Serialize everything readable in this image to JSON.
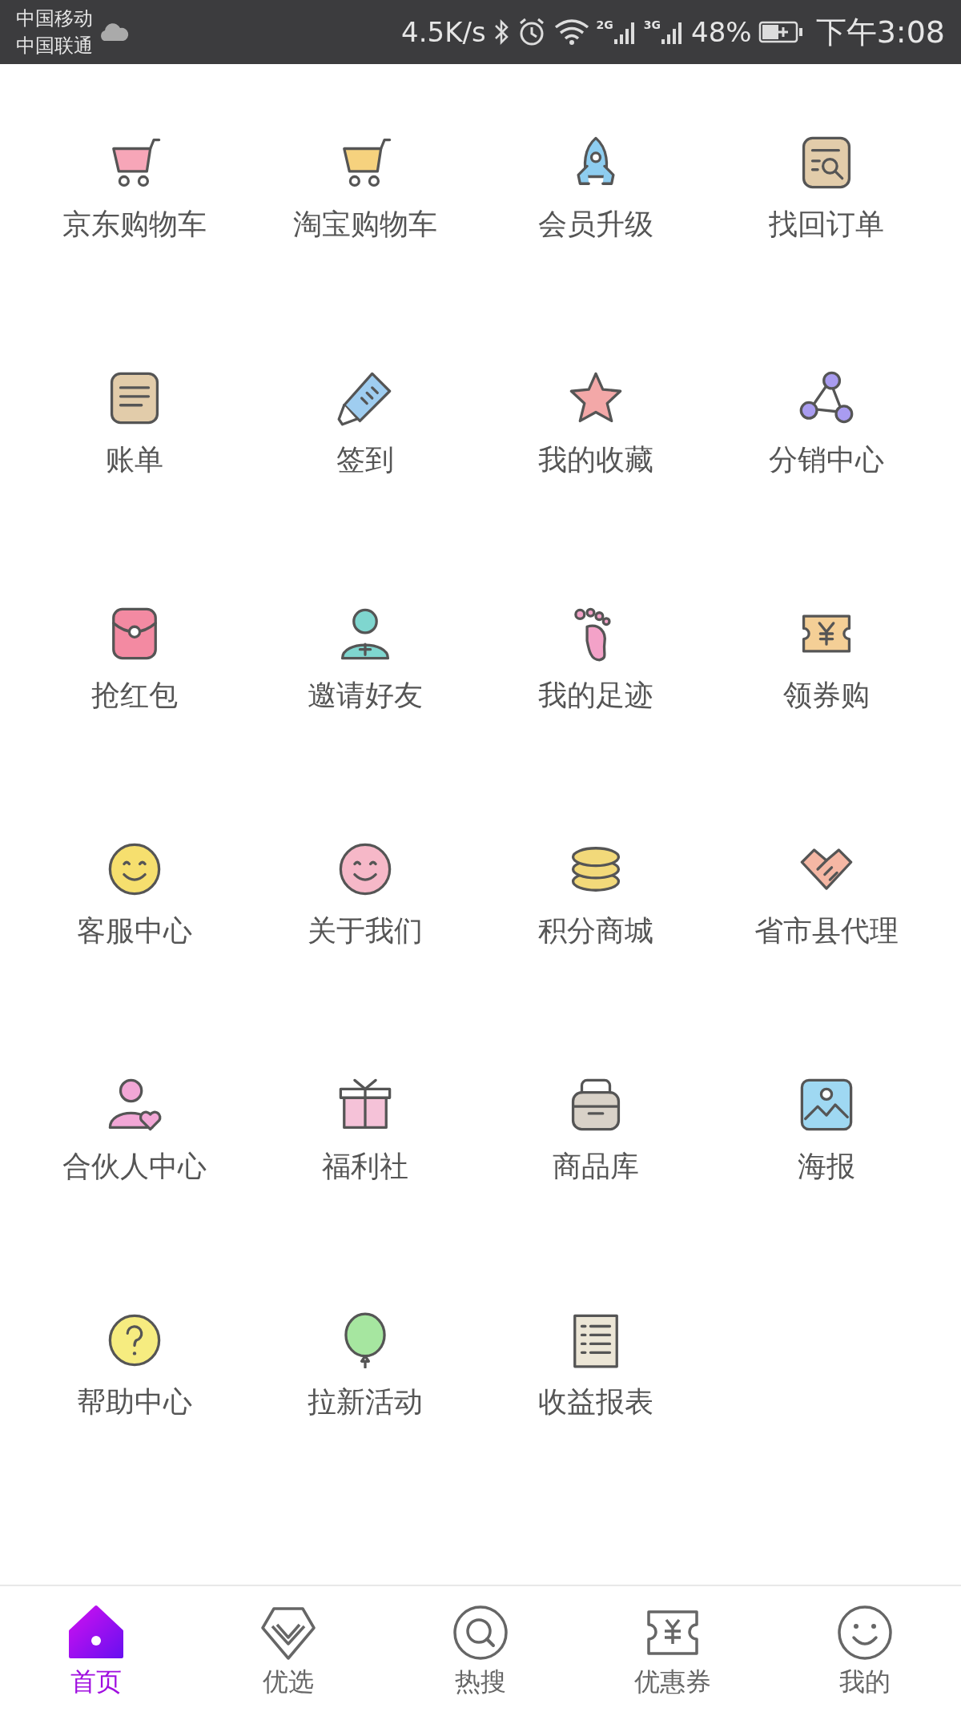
{
  "status_bar": {
    "carriers": [
      "中国移动",
      "中国联通"
    ],
    "speed": "4.5K/s",
    "networks": [
      "2G",
      "3G"
    ],
    "battery": "48%",
    "time": "下午3:08"
  },
  "grid": [
    {
      "label": "京东购物车",
      "kind": "cart",
      "color": "#f7a6b8"
    },
    {
      "label": "淘宝购物车",
      "kind": "cart",
      "color": "#f6d27e"
    },
    {
      "label": "会员升级",
      "kind": "rocket",
      "color": "#8ecdf0"
    },
    {
      "label": "找回订单",
      "kind": "search-doc",
      "color": "#e2ccaa"
    },
    {
      "label": "账单",
      "kind": "doc",
      "color": "#e2ccaa"
    },
    {
      "label": "签到",
      "kind": "bottle",
      "color": "#9fcdf0"
    },
    {
      "label": "我的收藏",
      "kind": "star",
      "color": "#f3a8a8"
    },
    {
      "label": "分销中心",
      "kind": "share",
      "color": "#a99cf0"
    },
    {
      "label": "抢红包",
      "kind": "packet",
      "color": "#f38aa2"
    },
    {
      "label": "邀请好友",
      "kind": "user-plus",
      "color": "#7fd6cf"
    },
    {
      "label": "我的足迹",
      "kind": "foot",
      "color": "#f3a2c8"
    },
    {
      "label": "领券购",
      "kind": "ticket",
      "color": "#f4cf96"
    },
    {
      "label": "客服中心",
      "kind": "smile",
      "color": "#f6df6e"
    },
    {
      "label": "关于我们",
      "kind": "smile",
      "color": "#f6b8c8"
    },
    {
      "label": "积分商城",
      "kind": "coins",
      "color": "#f2d97a"
    },
    {
      "label": "省市县代理",
      "kind": "hands",
      "color": "#f5b7a4"
    },
    {
      "label": "合伙人中心",
      "kind": "user-heart",
      "color": "#f2a7d6"
    },
    {
      "label": "福利社",
      "kind": "gift",
      "color": "#f5c2d8"
    },
    {
      "label": "商品库",
      "kind": "box",
      "color": "#d9d2c8"
    },
    {
      "label": "海报",
      "kind": "image",
      "color": "#9fd8f2"
    },
    {
      "label": "帮助中心",
      "kind": "question",
      "color": "#f6ec80"
    },
    {
      "label": "拉新活动",
      "kind": "balloon",
      "color": "#a6e6a0"
    },
    {
      "label": "收益报表",
      "kind": "list",
      "color": "#ece6d6"
    }
  ],
  "tab_bar": [
    {
      "label": "首页",
      "kind": "home",
      "selected": true
    },
    {
      "label": "优选",
      "kind": "diamond",
      "selected": false
    },
    {
      "label": "热搜",
      "kind": "search",
      "selected": false
    },
    {
      "label": "优惠券",
      "kind": "coupon",
      "selected": false
    },
    {
      "label": "我的",
      "kind": "face",
      "selected": false
    }
  ]
}
